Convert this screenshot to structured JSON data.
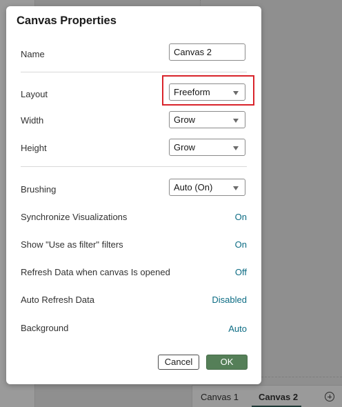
{
  "dialog": {
    "title": "Canvas Properties",
    "name": {
      "label": "Name",
      "value": "Canvas 2"
    },
    "layout": {
      "label": "Layout",
      "value": "Freeform"
    },
    "width": {
      "label": "Width",
      "value": "Grow"
    },
    "height": {
      "label": "Height",
      "value": "Grow"
    },
    "brushing": {
      "label": "Brushing",
      "value": "Auto (On)"
    },
    "sync_visualizations": {
      "label": "Synchronize Visualizations",
      "value": "On"
    },
    "use_as_filter": {
      "label": "Show \"Use as filter\" filters",
      "value": "On"
    },
    "refresh_on_open": {
      "label": "Refresh Data when canvas Is opened",
      "value": "Off"
    },
    "auto_refresh": {
      "label": "Auto Refresh Data",
      "value": "Disabled"
    },
    "background": {
      "label": "Background",
      "value": "Auto"
    },
    "buttons": {
      "cancel": "Cancel",
      "ok": "OK"
    }
  },
  "tabs": [
    "Canvas 1",
    "Canvas 2"
  ],
  "active_tab": "Canvas 2",
  "colors": {
    "accent_link": "#0b6b83",
    "ok_button": "#557f58",
    "highlight": "#d9232a"
  }
}
